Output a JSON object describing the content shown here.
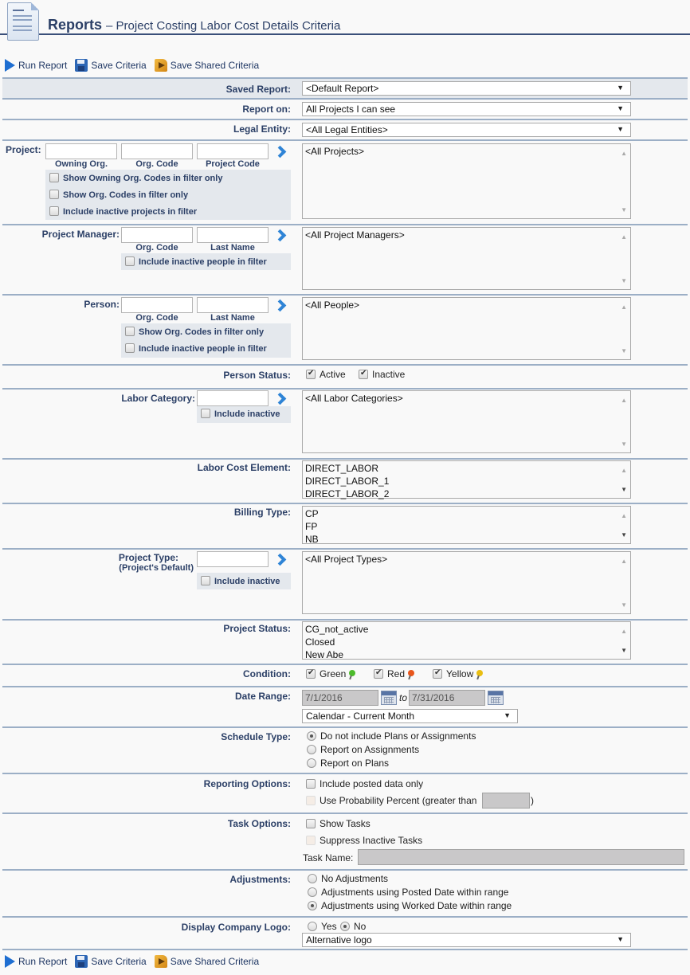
{
  "header": {
    "title": "Reports",
    "subtitle": "– Project Costing Labor Cost Details Criteria"
  },
  "toolbar": {
    "run_report": "Run Report",
    "save_criteria": "Save Criteria",
    "save_shared_criteria": "Save Shared Criteria"
  },
  "saved_report": {
    "label": "Saved Report:",
    "value": "<Default Report>"
  },
  "report_on": {
    "label": "Report on:",
    "value": "All Projects I can see"
  },
  "legal_entity": {
    "label": "Legal Entity:",
    "value": "<All Legal Entities>"
  },
  "project": {
    "label": "Project:",
    "fields": [
      "Owning Org.",
      "Org. Code",
      "Project Code"
    ],
    "options": [
      "Show Owning Org. Codes in filter only",
      "Show Org. Codes in filter only",
      "Include inactive projects in filter"
    ],
    "list": [
      "<All Projects>"
    ]
  },
  "project_manager": {
    "label": "Project Manager:",
    "fields": [
      "Org. Code",
      "Last Name"
    ],
    "options": [
      "Include inactive people in filter"
    ],
    "list": [
      "<All Project Managers>"
    ]
  },
  "person": {
    "label": "Person:",
    "fields": [
      "Org. Code",
      "Last Name"
    ],
    "options": [
      "Show Org. Codes in filter only",
      "Include inactive people in filter"
    ],
    "list": [
      "<All People>"
    ]
  },
  "person_status": {
    "label": "Person Status:",
    "options": [
      {
        "label": "Active",
        "checked": true
      },
      {
        "label": "Inactive",
        "checked": true
      }
    ]
  },
  "labor_category": {
    "label": "Labor Category:",
    "option": "Include inactive",
    "list": [
      "<All Labor Categories>"
    ]
  },
  "labor_cost_element": {
    "label": "Labor Cost Element:",
    "list": [
      "DIRECT_LABOR",
      "DIRECT_LABOR_1",
      "DIRECT_LABOR_2"
    ]
  },
  "billing_type": {
    "label": "Billing Type:",
    "list": [
      "CP",
      "FP",
      "NB"
    ]
  },
  "project_type": {
    "label": "Project Type:",
    "sublabel": "(Project's Default)",
    "option": "Include inactive",
    "list": [
      "<All Project Types>"
    ]
  },
  "project_status": {
    "label": "Project Status:",
    "list": [
      "CG_not_active",
      "Closed",
      "New Abe"
    ]
  },
  "condition": {
    "label": "Condition:",
    "options": [
      {
        "label": "Green",
        "checked": true,
        "color": "#4dbb2c"
      },
      {
        "label": "Red",
        "checked": true,
        "color": "#e8561c"
      },
      {
        "label": "Yellow",
        "checked": true,
        "color": "#e9be12"
      }
    ]
  },
  "date_range": {
    "label": "Date Range:",
    "from": "7/1/2016",
    "to_label": "to",
    "to": "7/31/2016",
    "preset": "Calendar - Current Month"
  },
  "schedule_type": {
    "label": "Schedule Type:",
    "options": [
      {
        "label": "Do not include Plans or Assignments",
        "selected": true
      },
      {
        "label": "Report on Assignments",
        "selected": false
      },
      {
        "label": "Report on Plans",
        "selected": false
      }
    ]
  },
  "reporting_options": {
    "label": "Reporting Options:",
    "posted_only": "Include posted data only",
    "probability": "Use Probability Percent (greater than",
    "probability_close": ")",
    "probability_value": ""
  },
  "task_options": {
    "label": "Task Options:",
    "show_tasks": "Show Tasks",
    "suppress_inactive": "Suppress Inactive Tasks",
    "task_name_label": "Task Name:",
    "task_name_value": ""
  },
  "adjustments": {
    "label": "Adjustments:",
    "options": [
      {
        "label": "No Adjustments",
        "selected": false
      },
      {
        "label": "Adjustments using Posted Date within range",
        "selected": false
      },
      {
        "label": "Adjustments using Worked Date within range",
        "selected": true
      }
    ]
  },
  "company_logo": {
    "label": "Display Company Logo:",
    "yes": "Yes",
    "no": "No",
    "selected": "No",
    "logo_value": "Alternative logo"
  }
}
